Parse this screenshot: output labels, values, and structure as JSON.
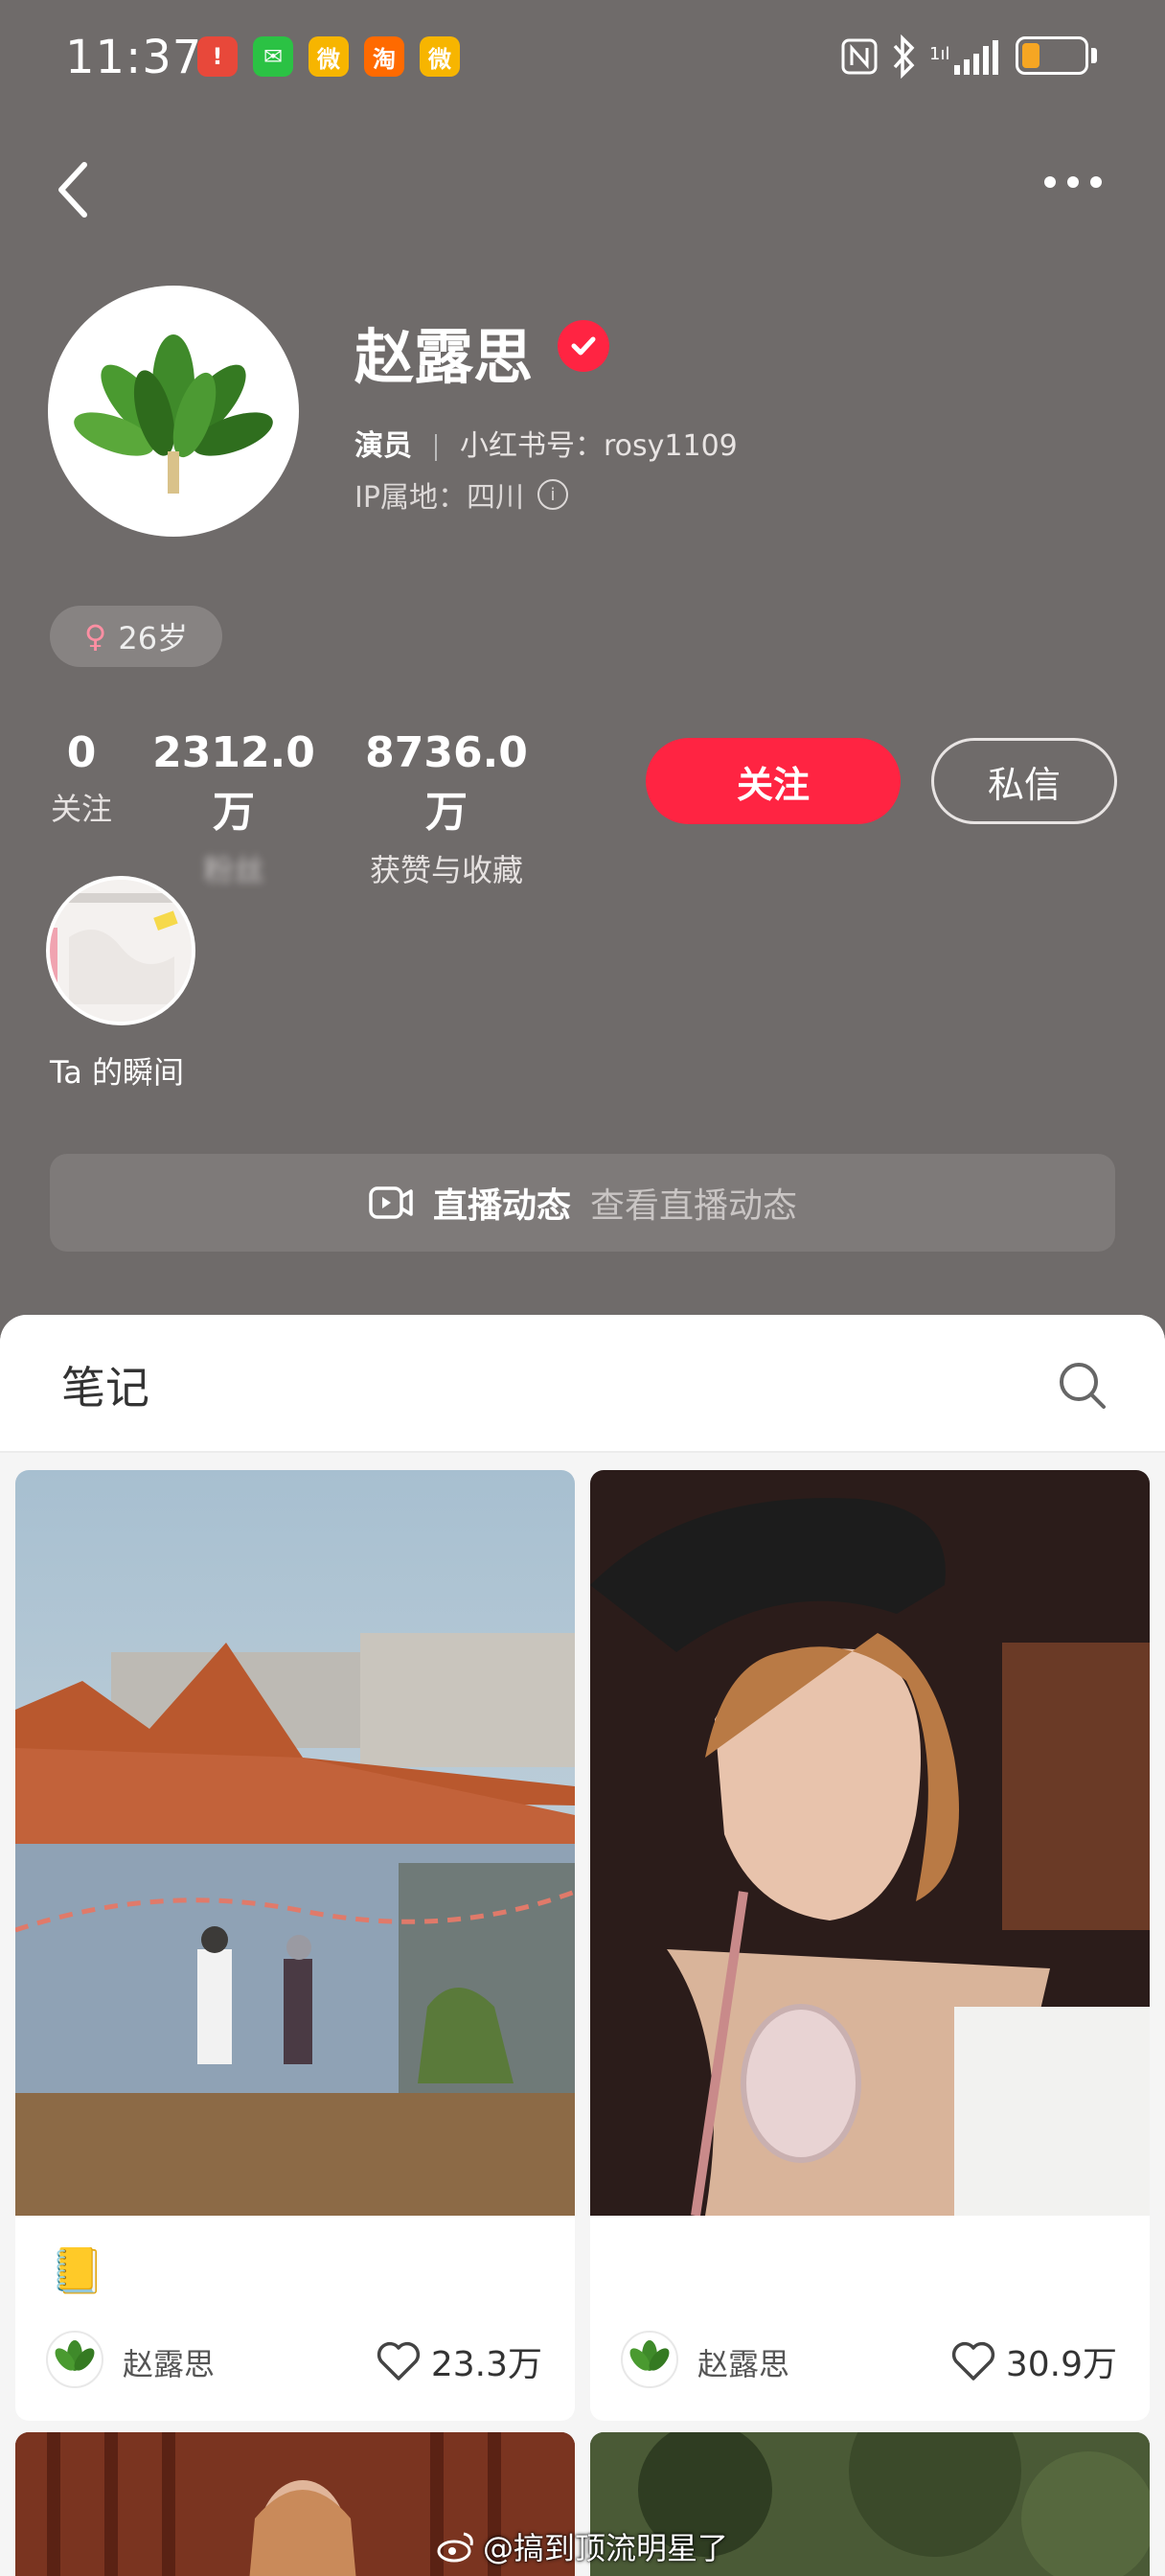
{
  "status_bar": {
    "time": "11:37",
    "apps": [
      {
        "icon": "notification-red-icon",
        "color": "#e8483a",
        "glyph": "!"
      },
      {
        "icon": "wechat-icon",
        "color": "#2bc244",
        "glyph": "✉"
      },
      {
        "icon": "weibo-icon",
        "color": "#f7b500",
        "glyph": "微"
      },
      {
        "icon": "taobao-icon",
        "color": "#ff6a00",
        "glyph": "淘"
      },
      {
        "icon": "weibo-icon-2",
        "color": "#f7b500",
        "glyph": "微"
      }
    ],
    "system_icons": [
      "nfc-icon",
      "bluetooth-icon",
      "signal-icon",
      "battery-icon"
    ],
    "battery_level": 0.2,
    "signal_label": "1ıl"
  },
  "nav": {
    "back_icon": "back-chevron-icon",
    "more_icon": "more-dots-icon"
  },
  "profile": {
    "name": "赵露思",
    "verified": true,
    "role": "演员",
    "id_label": "小红书号：rosy1109",
    "ip_label": "IP属地：四川",
    "info_glyph": "i",
    "gender_glyph": "♀",
    "age": "26岁"
  },
  "stats": [
    {
      "value": "0",
      "label": "关注"
    },
    {
      "value": "2312.0万",
      "label": "粉丝"
    },
    {
      "value": "8736.0万",
      "label": "获赞与收藏"
    }
  ],
  "actions": {
    "follow": "关注",
    "message": "私信"
  },
  "moment": {
    "label": "Ta 的瞬间"
  },
  "live": {
    "title": "直播动态",
    "subtitle": "查看直播动态"
  },
  "notes_section": {
    "tab": "笔记"
  },
  "notes": [
    {
      "emoji": "📒",
      "author": "赵露思",
      "likes": "23.3万"
    },
    {
      "emoji": "🐱",
      "author": "赵露思",
      "likes": "30.9万"
    }
  ],
  "watermark": "@搞到顶流明星了",
  "colors": {
    "accent": "#ff2442",
    "header_bg": "#6f6b6a",
    "sheet_bg": "#f5f5f5"
  }
}
